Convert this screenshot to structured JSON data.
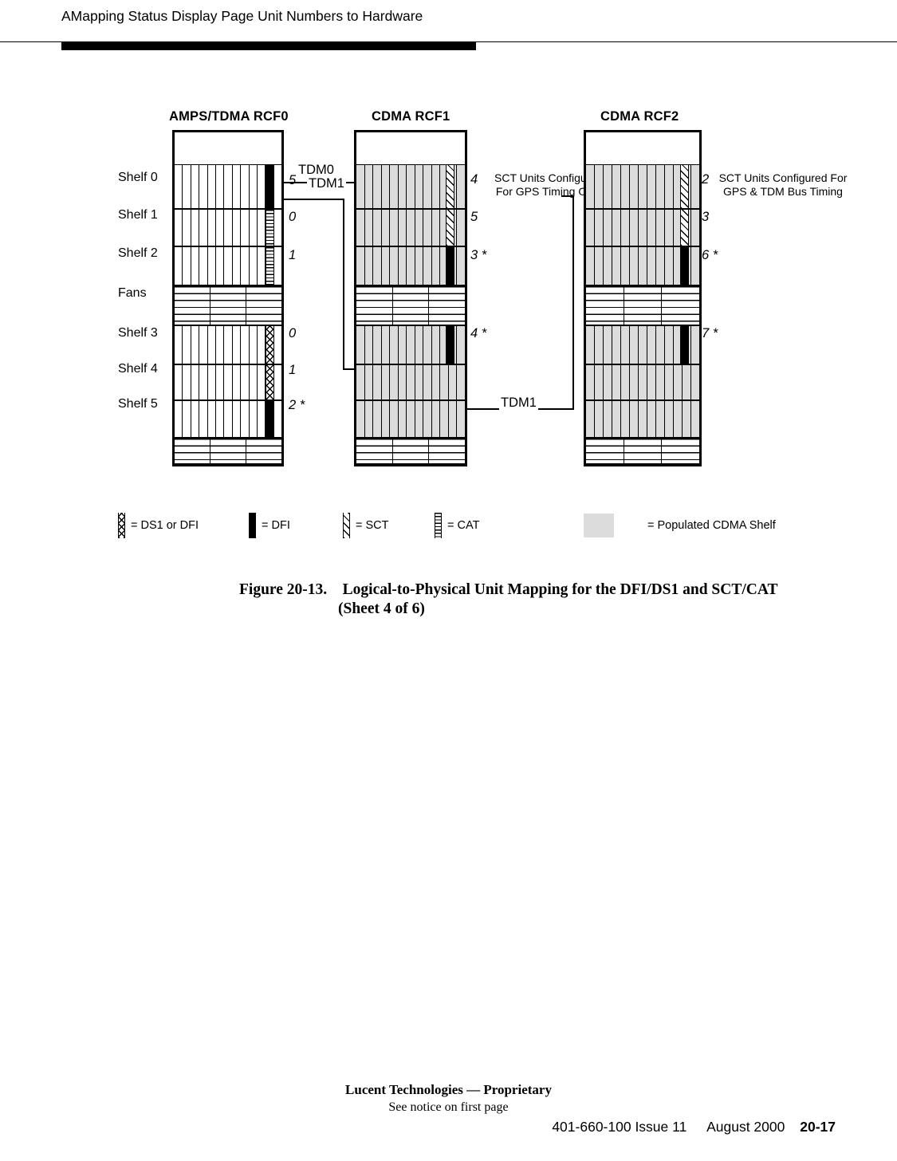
{
  "header": {
    "running_head": "AMapping Status Display Page Unit Numbers to Hardware"
  },
  "figure": {
    "racks": [
      {
        "id": "rcf0",
        "title": "AMPS/TDMA RCF0"
      },
      {
        "id": "rcf1",
        "title": "CDMA RCF1"
      },
      {
        "id": "rcf2",
        "title": "CDMA RCF2"
      }
    ],
    "shelf_labels": [
      "Shelf 0",
      "Shelf 1",
      "Shelf 2",
      "Fans",
      "Shelf 3",
      "Shelf 4",
      "Shelf 5"
    ],
    "rcf0_units": [
      "5",
      "0",
      "1",
      "0",
      "1",
      "2 *"
    ],
    "rcf1_units": [
      "4",
      "5",
      "3 *",
      "4 *"
    ],
    "rcf2_units": [
      "2",
      "3",
      "6 *",
      "7 *"
    ],
    "tdm_labels": {
      "tdm0": "TDM0",
      "tdm1_top": "TDM1",
      "tdm1_bottom": "TDM1"
    },
    "notes": {
      "rcf1_sct": "SCT Units Configured For GPS Timing Only",
      "rcf2_sct": "SCT Units Configured For GPS & TDM Bus Timing"
    }
  },
  "legend": {
    "items": [
      {
        "pattern": "ds1-or-dfi-swatch",
        "label": "=  DS1 or DFI"
      },
      {
        "pattern": "dfi-swatch",
        "label": "=  DFI"
      },
      {
        "pattern": "sct-swatch",
        "label": "=  SCT"
      },
      {
        "pattern": "cat-swatch",
        "label": "=  CAT"
      },
      {
        "pattern": "populated-shelf-swatch",
        "label": "=  Populated CDMA Shelf"
      }
    ]
  },
  "caption": {
    "number": "Figure 20-13.",
    "line1": "Logical-to-Physical Unit Mapping for the DFI/DS1 and SCT/CAT",
    "line2": "(Sheet 4 of 6)"
  },
  "footer": {
    "proprietary": "Lucent Technologies — Proprietary",
    "notice": "See notice on first page",
    "doc_number": "401-660-100 Issue 11",
    "date": "August 2000",
    "page": "20-17"
  }
}
